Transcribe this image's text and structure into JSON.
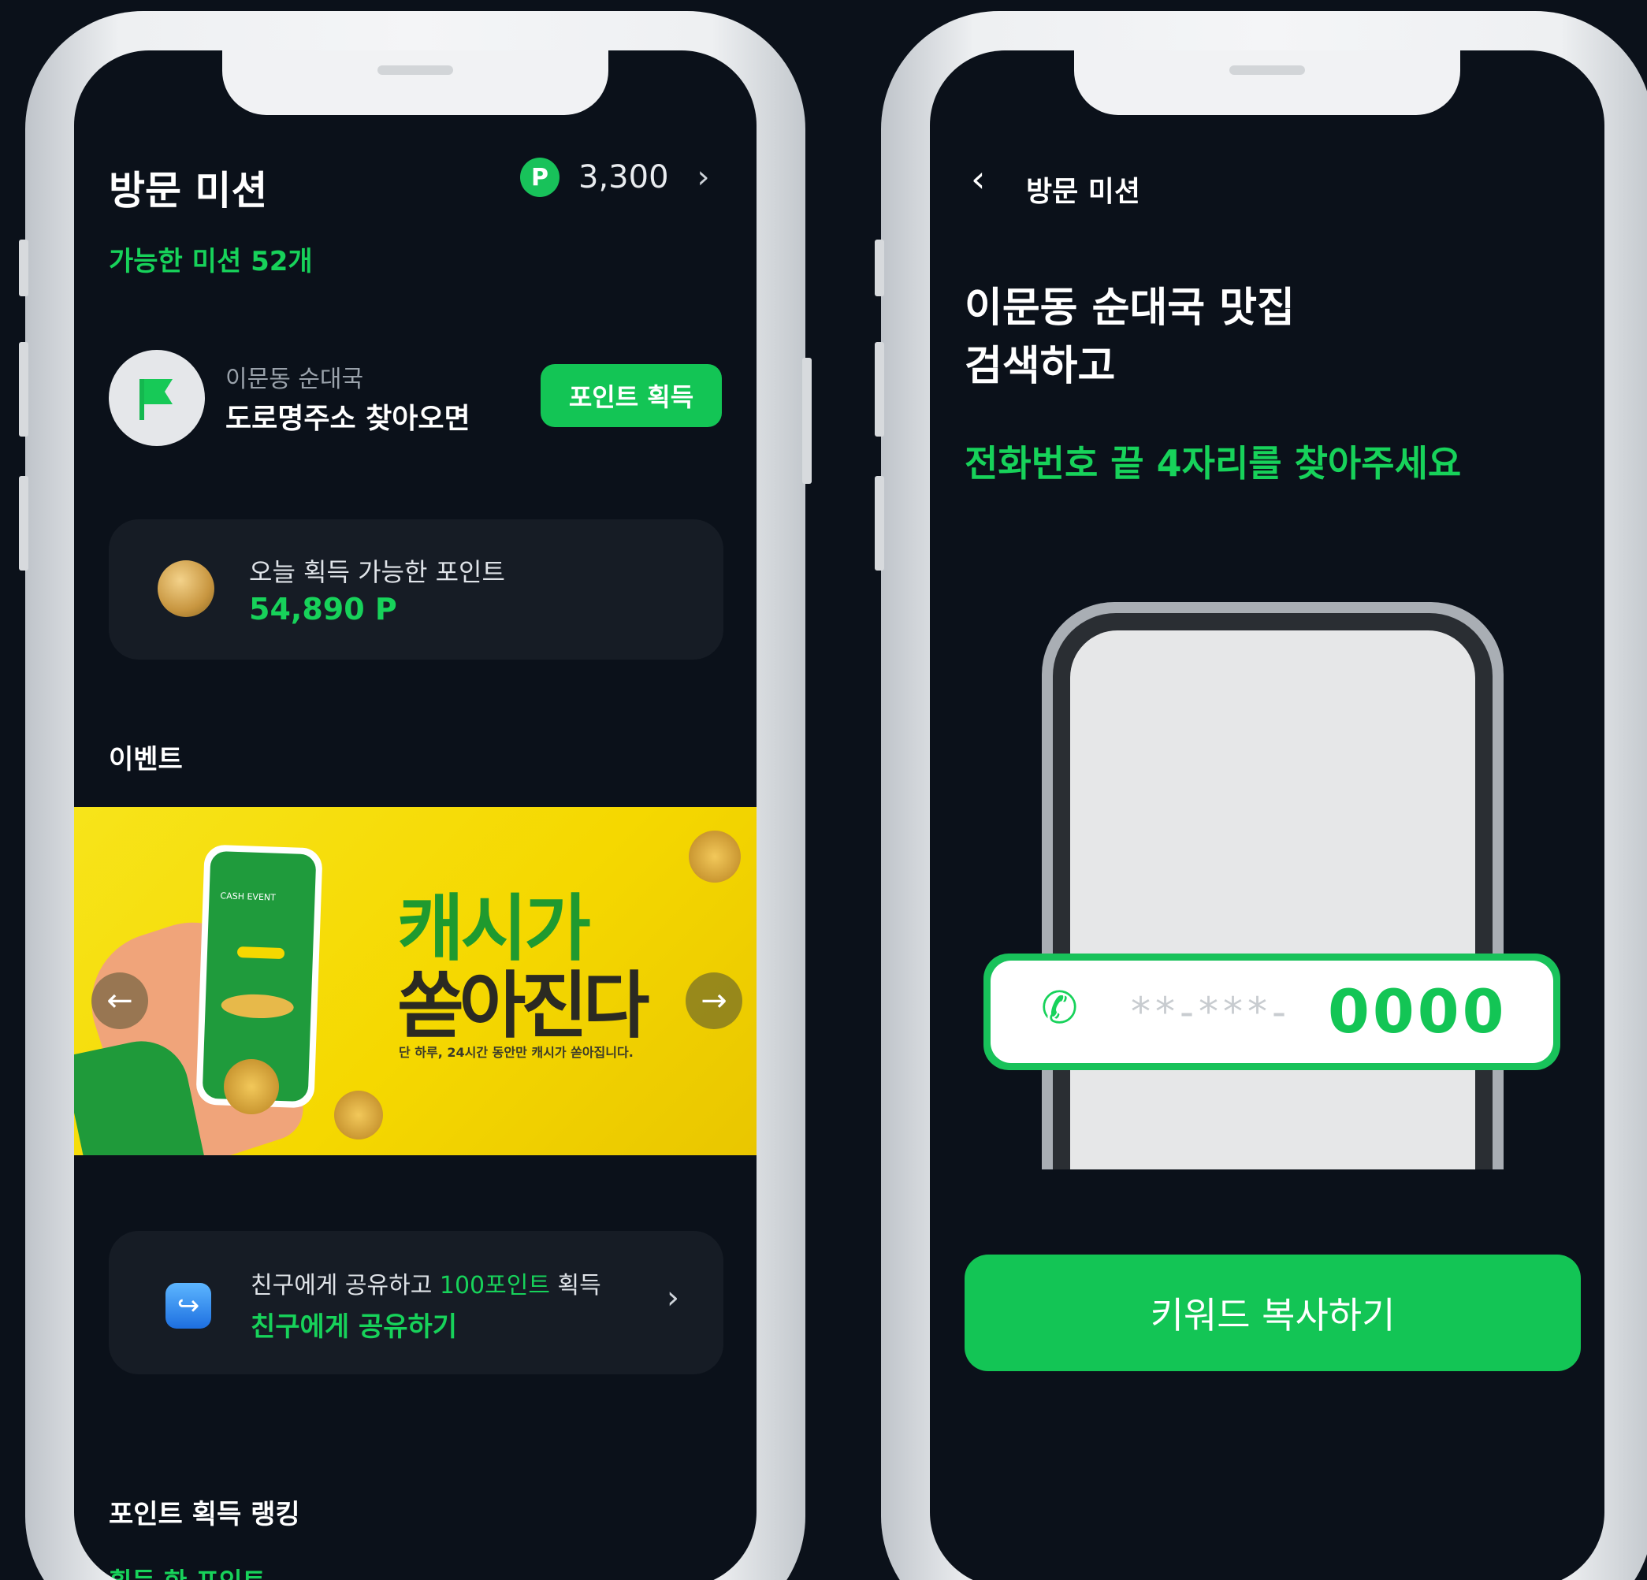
{
  "left": {
    "header": {
      "title": "방문 미션",
      "points": "3,300",
      "badge": "P"
    },
    "missions_count": "가능한 미션 52개",
    "mission": {
      "place": "이문동 순대국",
      "desc": "도로명주소 찾아오면",
      "button": "포인트 획득"
    },
    "today_card": {
      "label": "오늘 획득 가능한 포인트",
      "value": "54,890 P"
    },
    "event_section": "이벤트",
    "banner": {
      "headline1": "캐시가",
      "headline2": "쏟아진다",
      "sub": "단 하루, 24시간 동안만 캐시가 쏟아집니다.",
      "phone_text": "CASH EVENT"
    },
    "share_card": {
      "line1_prefix": "친구에게 공유하고 ",
      "line1_highlight": "100포인트",
      "line1_suffix": " 획득",
      "line2": "친구에게 공유하기"
    },
    "ranking_title": "포인트 획득 랭킹",
    "ranking_sub": "획득 한 포인트"
  },
  "right": {
    "nav_title": "방문 미션",
    "heading_line1": "이문동 순대국 맛집",
    "heading_line2": "검색하고",
    "instruction": "전화번호 끝 4자리를 찾아주세요",
    "phone_masked": "**-***-",
    "phone_digits": "0000",
    "copy_button": "키워드 복사하기"
  },
  "colors": {
    "accent": "#17d25a",
    "background": "#0b111a",
    "card": "#161c25",
    "banner": "#f5d800"
  },
  "icons": [
    "flag-icon",
    "coin-icon",
    "share-icon",
    "phone-call-icon",
    "back-icon",
    "chevron-right-icon",
    "arrow-left-icon",
    "arrow-right-icon"
  ]
}
